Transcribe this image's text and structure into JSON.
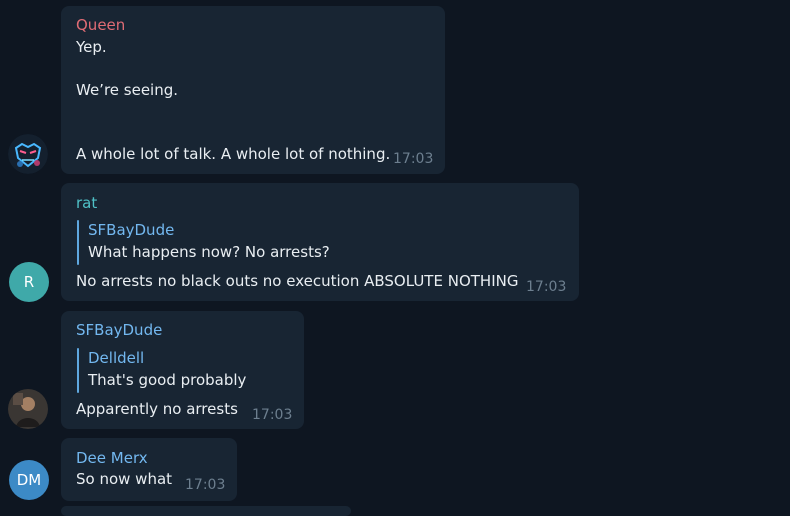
{
  "messages": [
    {
      "sender": "Queen",
      "sender_color": "#e06c75",
      "lines": [
        "Yep.",
        "We’re seeing.",
        "A whole lot of talk. A whole lot of nothing."
      ],
      "time": "17:03",
      "avatar": {
        "kind": "image",
        "icon": "masked-face-avatar-icon"
      }
    },
    {
      "sender": "rat",
      "sender_color": "#4fc1c7",
      "reply": {
        "name": "SFBayDude",
        "text": "What happens now? No arrests?"
      },
      "text": "No arrests no black outs no execution ABSOLUTE NOTHING",
      "time": "17:03",
      "avatar": {
        "kind": "initials",
        "initials": "R",
        "color": "#3fa9a9"
      }
    },
    {
      "sender": "SFBayDude",
      "sender_color": "#73b8f0",
      "reply": {
        "name": "Delldell",
        "text": "That's good probably"
      },
      "text": "Apparently no arrests",
      "time": "17:03",
      "avatar": {
        "kind": "image",
        "icon": "person-photo-avatar-icon"
      }
    },
    {
      "sender": "Dee Merx",
      "sender_color": "#73b8f0",
      "text": "So now what",
      "time": "17:03",
      "avatar": {
        "kind": "initials",
        "initials": "DM",
        "color": "#3c8ac6"
      }
    }
  ]
}
